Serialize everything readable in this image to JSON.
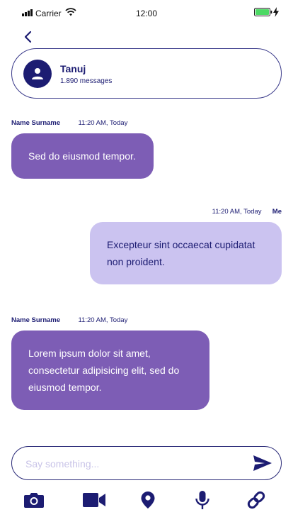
{
  "status_bar": {
    "carrier": "Carrier",
    "time": "12:00"
  },
  "contact": {
    "name": "Tanuj",
    "subtitle": "1.890 messages"
  },
  "messages": [
    {
      "sender": "Name Surname",
      "time": "11:20 AM, Today",
      "text": "Sed do eiusmod tempor."
    },
    {
      "sender": "Me",
      "time": "11:20 AM, Today",
      "text": "Excepteur sint occaecat cupidatat non proident."
    },
    {
      "sender": "Name Surname",
      "time": "11:20 AM, Today",
      "text": "Lorem ipsum dolor sit amet, consectetur adipisicing elit, sed do eiusmod tempor."
    }
  ],
  "composer": {
    "placeholder": "Say something..."
  },
  "colors": {
    "primary": "#1c1c72",
    "incoming_bubble": "#7d5db5",
    "outgoing_bubble": "#cbc3f0",
    "battery": "#4cd964"
  },
  "icons": [
    "back-chevron-icon",
    "user-icon",
    "send-icon",
    "camera-icon",
    "video-icon",
    "location-pin-icon",
    "microphone-icon",
    "link-icon"
  ]
}
